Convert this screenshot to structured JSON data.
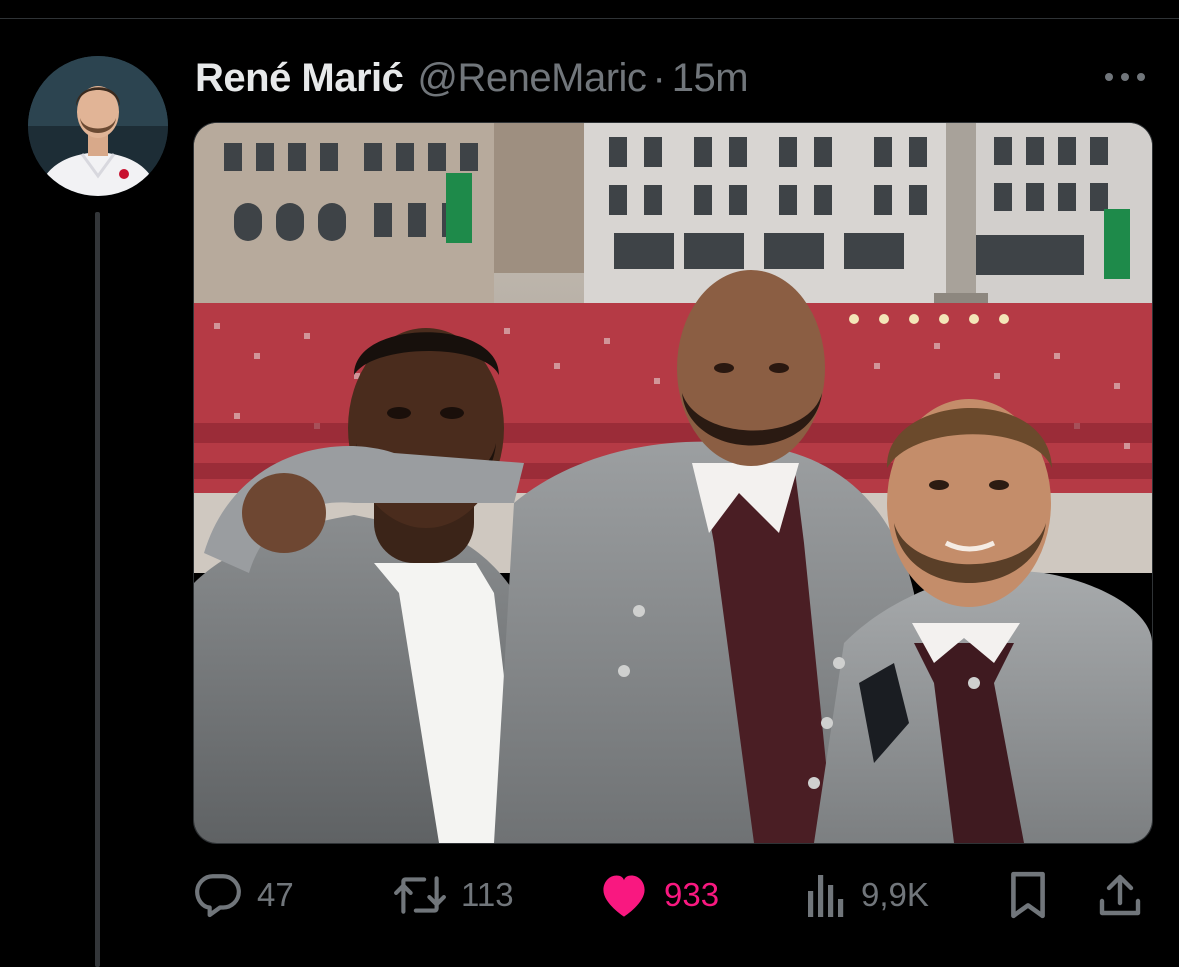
{
  "tweet": {
    "display_name": "René Marić",
    "handle": "@ReneMaric",
    "separator": "·",
    "time": "15m"
  },
  "actions": {
    "replies": "47",
    "retweets": "113",
    "likes": "933",
    "views": "9,9K"
  },
  "icons": {
    "more": "more-icon",
    "reply": "reply-icon",
    "retweet": "retweet-icon",
    "like": "heart-icon",
    "views": "views-icon",
    "bookmark": "bookmark-icon",
    "share": "share-icon"
  },
  "colors": {
    "background": "#000000",
    "text": "#e7e9ea",
    "muted": "#71767b",
    "like": "#f91880",
    "divider": "#2f3336"
  }
}
